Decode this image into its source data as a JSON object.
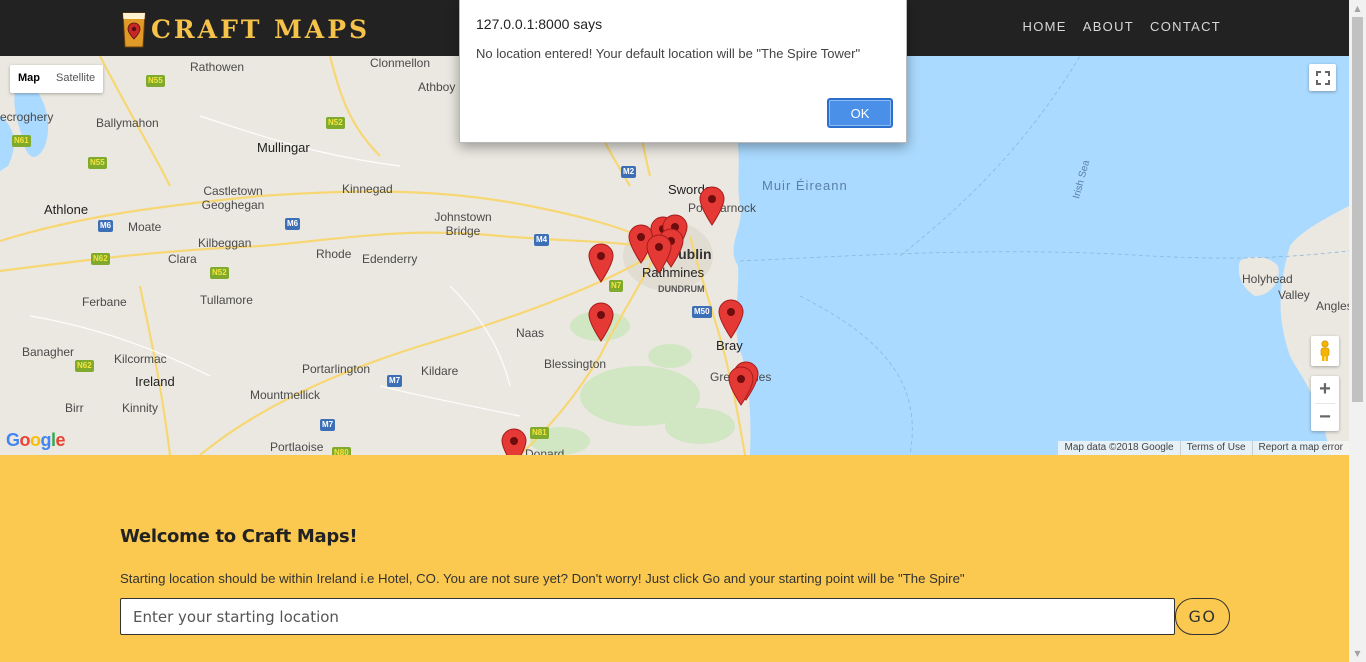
{
  "header": {
    "brand": "CRAFT MAPS",
    "nav": [
      "HOME",
      "ABOUT",
      "CONTACT"
    ]
  },
  "map": {
    "type_buttons": [
      "Map",
      "Satellite"
    ],
    "footer": [
      "Map data ©2018 Google",
      "Terms of Use",
      "Report a map error"
    ],
    "places": [
      "Rathowen",
      "Clonmellon",
      "Athboy",
      "Ballymahon",
      "Mullingar",
      "Castletown Geoghegan",
      "Kinnegad",
      "Johnstown Bridge",
      "Athlone",
      "Moate",
      "Kilbeggan",
      "Rhode",
      "Edenderry",
      "Clara",
      "Tullamore",
      "Ferbane",
      "Naas",
      "Banagher",
      "Kilcormac",
      "Portarlington",
      "Kildare",
      "Blessington",
      "Ireland",
      "Mountmellick",
      "Birr",
      "Kinnity",
      "Portlaoise",
      "Donard",
      "Swords",
      "Portmarnock",
      "Dublin",
      "Rathmines",
      "DUNDRUM",
      "Bray",
      "Greystones",
      "Muir Éireann",
      "Irish Sea",
      "Holyhead",
      "Valley",
      "Angles",
      "ecroghery"
    ],
    "roads": [
      "N55",
      "N52",
      "N61",
      "N55",
      "M6",
      "M6",
      "N62",
      "N52",
      "M4",
      "N7",
      "M2",
      "M50",
      "N62",
      "M7",
      "M7",
      "N81",
      "N80"
    ],
    "pin_count": 12
  },
  "dialog": {
    "title": "127.0.0.1:8000 says",
    "message": "No location entered! Your default location will be \"The Spire Tower\"",
    "ok": "OK"
  },
  "content": {
    "welcome": "Welcome to Craft Maps!",
    "hint": "Starting location should be within Ireland i.e Hotel, CO. You are not sure yet? Don't worry! Just click Go and your starting point will be \"The Spire\"",
    "input_placeholder": "Enter your starting location",
    "go": "GO"
  },
  "colors": {
    "navbar": "#222222",
    "brand": "#f5c24a",
    "content_bg": "#fbc94f",
    "sea": "#aadaff",
    "pin": "#e53935",
    "ok_button": "#4a90e8"
  }
}
